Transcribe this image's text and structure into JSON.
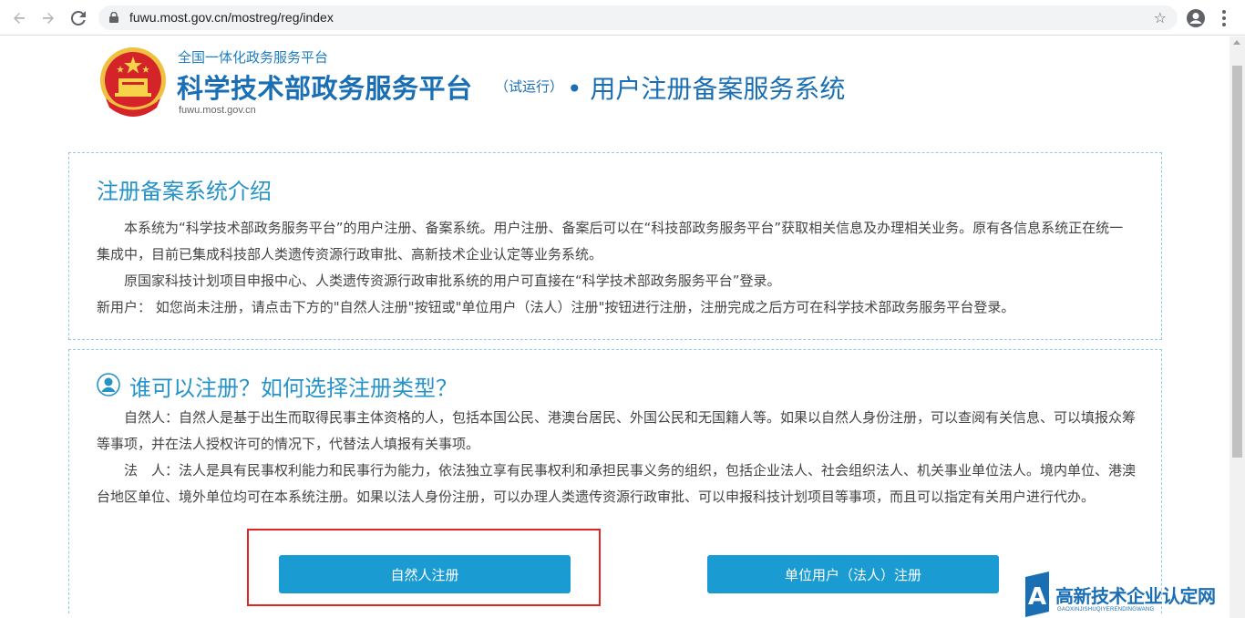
{
  "browser": {
    "url": "fuwu.most.gov.cn/mostreg/reg/index"
  },
  "header": {
    "platform_sub": "全国一体化政务服务平台",
    "platform_title": "科学技术部政务服务平台",
    "trial": "（试运行）",
    "system_name": "• 用户注册备案服务系统",
    "domain": "fuwu.most.gov.cn"
  },
  "intro": {
    "title": "注册备案系统介绍",
    "paragraphs": [
      "　　本系统为“科学技术部政务服务平台”的用户注册、备案系统。用户注册、备案后可以在“科技部政务服务平台”获取相关信息及办理相关业务。原有各信息系统正在统一集成中，目前已集成科技部人类遗传资源行政审批、高新技术企业认定等业务系统。",
      "　　原国家科技计划项目申报中心、人类遗传资源行政审批系统的用户可直接在“科学技术部政务服务平台”登录。",
      "新用户： 如您尚未注册，请点击下方的\"自然人注册\"按钮或\"单位用户（法人）注册\"按钮进行注册，注册完成之后方可在科学技术部政务服务平台登录。"
    ]
  },
  "who": {
    "title": "谁可以注册？如何选择注册类型？",
    "paragraphs": [
      "　　自然人：自然人是基于出生而取得民事主体资格的人，包括本国公民、港澳台居民、外国公民和无国籍人等。如果以自然人身份注册，可以查阅有关信息、可以填报众筹等事项，并在法人授权许可的情况下，代替法人填报有关事项。",
      "　　法　人：法人是具有民事权利能力和民事行为能力，依法独立享有民事权利和承担民事义务的组织，包括企业法人、社会组织法人、机关事业单位法人。境内单位、港澳台地区单位、境外单位均可在本系统注册。如果以法人身份注册，可以办理人类遗传资源行政审批、可以申报科技计划项目等事项，而且可以指定有关用户进行代办。"
    ]
  },
  "buttons": {
    "natural_person": "自然人注册",
    "legal_person": "单位用户（法人）注册"
  },
  "watermark": {
    "title": "高新技术企业认定网",
    "subtitle": "GAOXINJISHUQIYERENDINGWANG"
  },
  "colors": {
    "accent": "#1a9bd1",
    "title_blue": "#1a6fb4",
    "highlight_red": "#e02525"
  }
}
